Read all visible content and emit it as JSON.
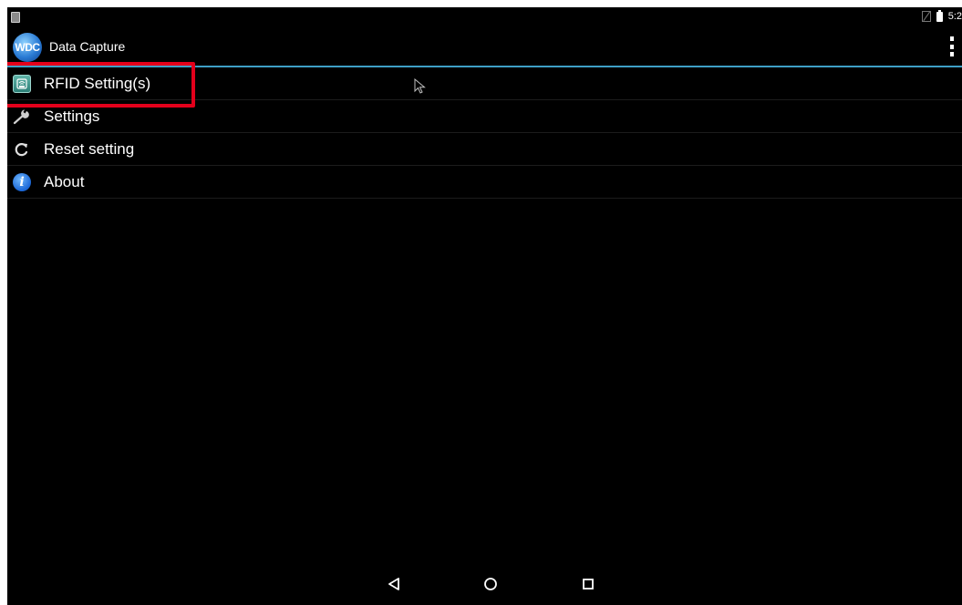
{
  "status_bar": {
    "time": "5:2"
  },
  "action_bar": {
    "logo_text": "WDC",
    "title": "Data Capture",
    "overflow_icon": "overflow-menu-icon"
  },
  "menu": {
    "items": [
      {
        "label": "RFID Setting(s)",
        "icon": "rfid-icon",
        "highlighted": true
      },
      {
        "label": "Settings",
        "icon": "wrench-icon"
      },
      {
        "label": "Reset setting",
        "icon": "reset-icon"
      },
      {
        "label": "About",
        "icon": "info-icon",
        "icon_glyph": "i"
      }
    ]
  },
  "nav_bar": {
    "back_icon": "back-icon",
    "home_icon": "home-icon",
    "recents_icon": "recents-icon"
  },
  "colors": {
    "accent_line": "#3e9fc6",
    "highlight": "#e3001b",
    "background": "#000000"
  }
}
